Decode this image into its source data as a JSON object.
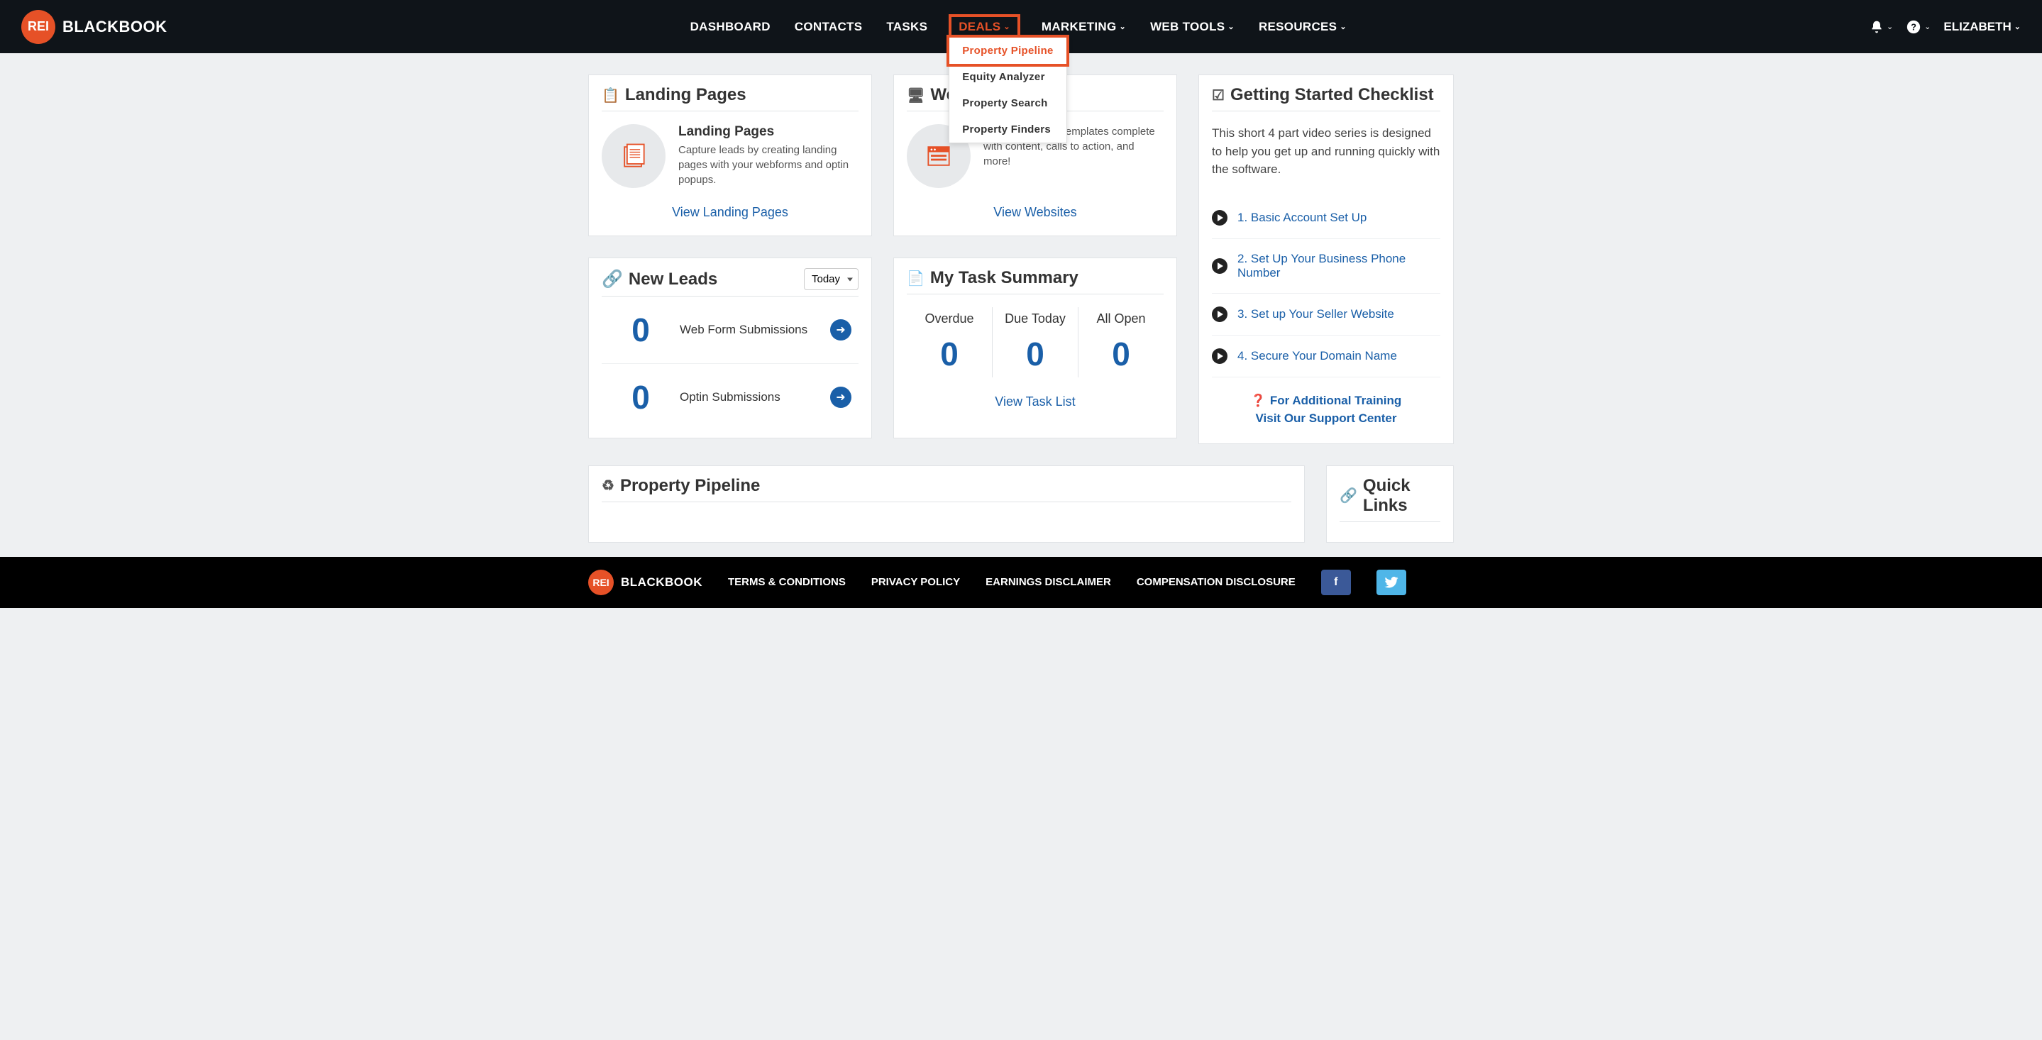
{
  "logo": {
    "badge": "REI",
    "text": "BLACKBOOK"
  },
  "nav": {
    "items": [
      {
        "label": "DASHBOARD",
        "dropdown": false
      },
      {
        "label": "CONTACTS",
        "dropdown": false
      },
      {
        "label": "TASKS",
        "dropdown": false
      },
      {
        "label": "DEALS",
        "dropdown": true,
        "active": true
      },
      {
        "label": "MARKETING",
        "dropdown": true
      },
      {
        "label": "WEB TOOLS",
        "dropdown": true
      },
      {
        "label": "RESOURCES",
        "dropdown": true
      }
    ],
    "deals_menu": [
      {
        "label": "Property Pipeline",
        "active": true
      },
      {
        "label": "Equity Analyzer"
      },
      {
        "label": "Property Search"
      },
      {
        "label": "Property Finders"
      }
    ],
    "user": "ELIZABETH"
  },
  "cards": {
    "landing": {
      "title": "Landing Pages",
      "heading": "Landing Pages",
      "desc": "Capture leads by creating landing pages with your webforms and optin popups.",
      "link": "View Landing Pages"
    },
    "websites": {
      "title": "Websites",
      "desc": "Build a site from templates complete with content, calls to action, and more!",
      "link": "View Websites"
    },
    "leads": {
      "title": "New Leads",
      "filter_selected": "Today",
      "rows": [
        {
          "count": "0",
          "label": "Web Form Submissions"
        },
        {
          "count": "0",
          "label": "Optin Submissions"
        }
      ]
    },
    "tasks": {
      "title": "My Task Summary",
      "cols": [
        {
          "label": "Overdue",
          "value": "0"
        },
        {
          "label": "Due Today",
          "value": "0"
        },
        {
          "label": "All Open",
          "value": "0"
        }
      ],
      "link": "View Task List"
    }
  },
  "checklist": {
    "title": "Getting Started Checklist",
    "desc": "This short 4 part video series is designed to help you get up and running quickly with the software.",
    "items": [
      "1. Basic Account Set Up",
      "2. Set Up Your Business Phone Number",
      "3. Set up Your Seller Website",
      "4. Secure Your Domain Name"
    ],
    "support1": "For Additional Training",
    "support2": "Visit Our Support Center"
  },
  "pipeline": {
    "title": "Property Pipeline"
  },
  "quicklinks": {
    "title": "Quick Links"
  },
  "footer": {
    "links": [
      "TERMS & CONDITIONS",
      "PRIVACY POLICY",
      "EARNINGS DISCLAIMER",
      "COMPENSATION DISCLOSURE"
    ]
  }
}
